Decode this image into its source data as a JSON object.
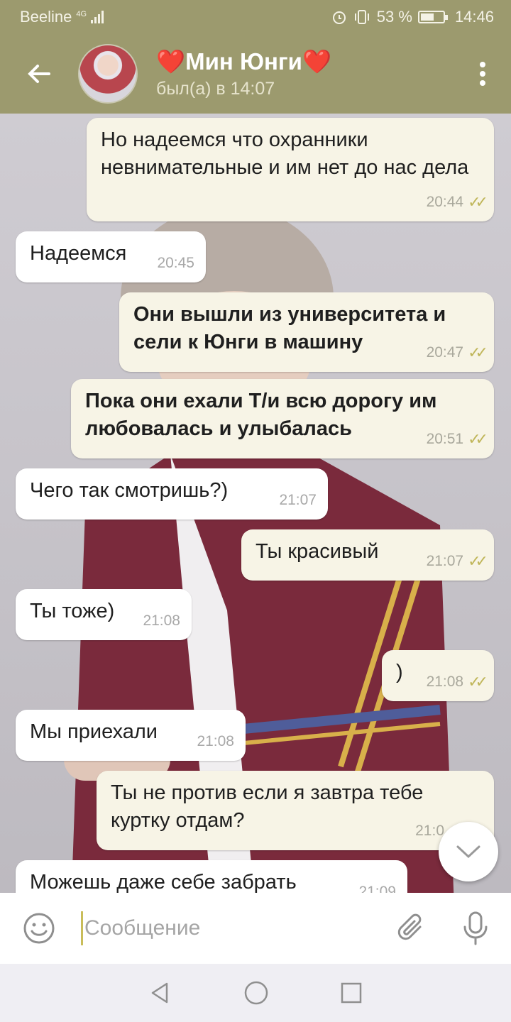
{
  "status_bar": {
    "carrier": "Beeline",
    "network": "4G",
    "battery": "53 %",
    "time": "14:46"
  },
  "header": {
    "name": "❤️Мин Юнги❤️",
    "status": "был(а) в 14:07"
  },
  "messages": [
    {
      "dir": "out",
      "text": "Но надеемся что охранники невнимательные и им нет до нас дела",
      "time": "20:44"
    },
    {
      "dir": "in",
      "text": "Надеемся",
      "time": "20:45"
    },
    {
      "dir": "out",
      "text": "Они вышли из университета и сели к Юнги в машину",
      "time": "20:47"
    },
    {
      "dir": "out",
      "text": "Пока они ехали Т/и всю дорогу им любовалась и улыбалась",
      "time": "20:51"
    },
    {
      "dir": "in",
      "text": "Чего так смотришь?)",
      "time": "21:07"
    },
    {
      "dir": "out",
      "text": "Ты красивый",
      "time": "21:07"
    },
    {
      "dir": "in",
      "text": "Ты тоже)",
      "time": "21:08"
    },
    {
      "dir": "out",
      "text": ")",
      "time": "21:08"
    },
    {
      "dir": "in",
      "text": "Мы приехали",
      "time": "21:08"
    },
    {
      "dir": "out",
      "text": "Ты не против если я завтра тебе куртку отдам?",
      "time": "21:0"
    },
    {
      "dir": "in",
      "text": "Можешь даже себе забрать",
      "time": "21:09"
    }
  ],
  "input": {
    "placeholder": "Сообщение"
  },
  "colors": {
    "header": "#9c9a6e",
    "outgoing_bubble": "#f7f4e6",
    "incoming_bubble": "#ffffff",
    "checks": "#c0b65a"
  },
  "icons": [
    "back-arrow-icon",
    "more-vert-icon",
    "double-check-icon",
    "chevron-down-icon",
    "emoji-icon",
    "attach-icon",
    "mic-icon",
    "nav-back-icon",
    "nav-home-icon",
    "nav-recents-icon"
  ]
}
